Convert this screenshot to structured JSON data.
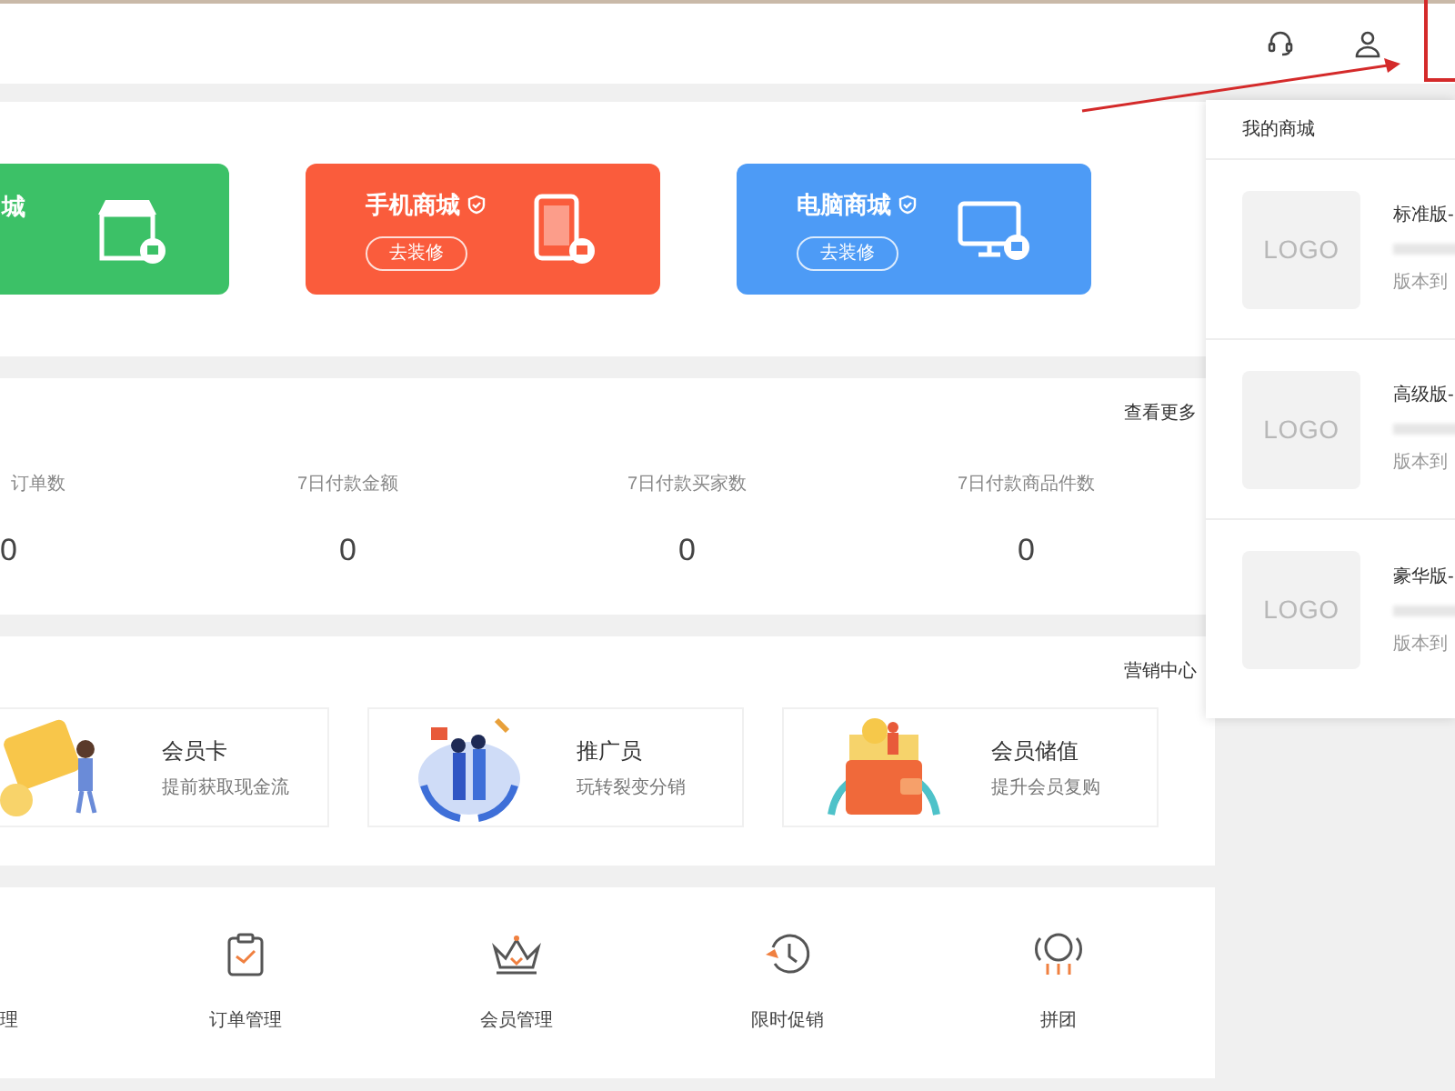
{
  "store_cards": [
    {
      "title": "城",
      "verified": false,
      "color": "#3cc167",
      "kind": "store"
    },
    {
      "title": "手机商城",
      "verified": true,
      "button": "去装修",
      "color": "#fa5c3c",
      "kind": "phone"
    },
    {
      "title": "电脑商城",
      "verified": true,
      "button": "去装修",
      "color": "#4d9bf6",
      "kind": "desktop"
    }
  ],
  "stats": {
    "more_link": "查看更多",
    "items": [
      {
        "label": "订单数",
        "value": "0"
      },
      {
        "label": "7日付款金额",
        "value": "0"
      },
      {
        "label": "7日付款买家数",
        "value": "0"
      },
      {
        "label": "7日付款商品件数",
        "value": "0"
      }
    ]
  },
  "marketing": {
    "link": "营销中心",
    "items": [
      {
        "title": "会员卡",
        "subtitle": "提前获取现金流",
        "kind": "card"
      },
      {
        "title": "推广员",
        "subtitle": "玩转裂变分销",
        "kind": "team"
      },
      {
        "title": "会员储值",
        "subtitle": "提升会员复购",
        "kind": "wallet"
      }
    ]
  },
  "tools": [
    {
      "label": "理",
      "kind": "none"
    },
    {
      "label": "订单管理",
      "kind": "clipboard"
    },
    {
      "label": "会员管理",
      "kind": "crown"
    },
    {
      "label": "限时促销",
      "kind": "clock"
    },
    {
      "label": "拼团",
      "kind": "group"
    }
  ],
  "store_menu": {
    "title": "我的商城",
    "items": [
      {
        "logo": "LOGO",
        "name": "标准版-",
        "expiry": "版本到"
      },
      {
        "logo": "LOGO",
        "name": "高级版-",
        "expiry": "版本到"
      },
      {
        "logo": "LOGO",
        "name": "豪华版-",
        "expiry": "版本到"
      }
    ]
  }
}
